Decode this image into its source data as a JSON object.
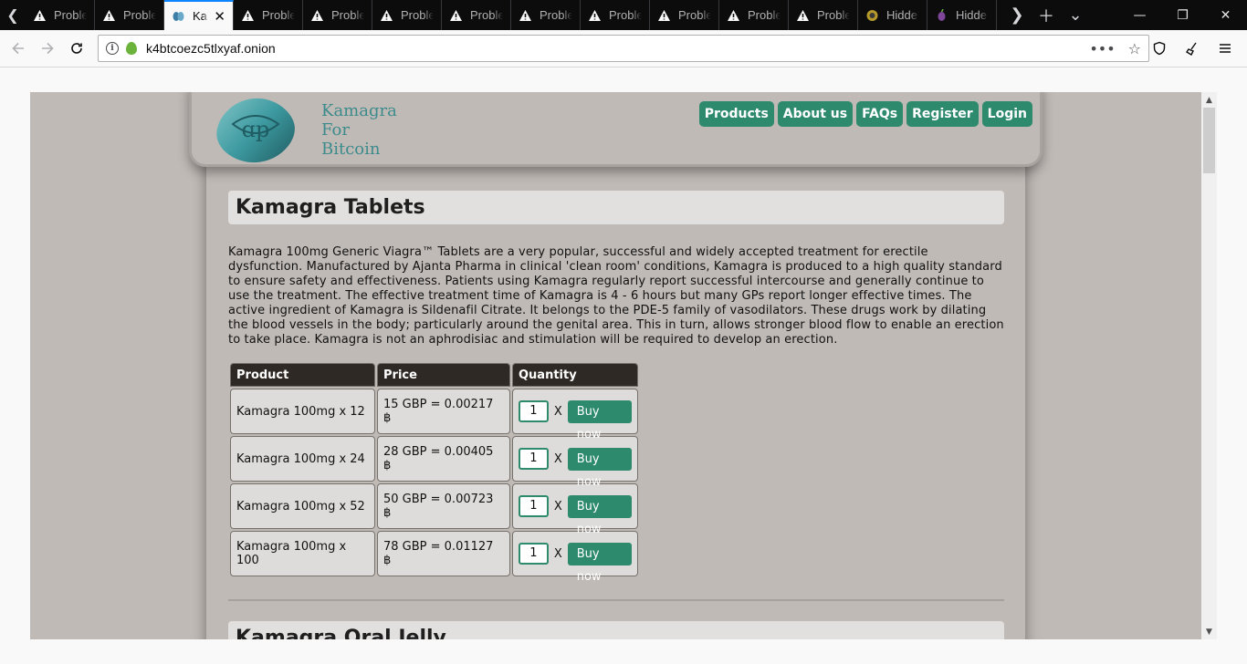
{
  "browser": {
    "tabs": [
      {
        "label": "Proble",
        "icon": "warning-icon"
      },
      {
        "label": "Proble",
        "icon": "warning-icon"
      },
      {
        "label": "Ka",
        "icon": "site-icon",
        "active": true
      },
      {
        "label": "Proble",
        "icon": "warning-icon"
      },
      {
        "label": "Proble",
        "icon": "warning-icon"
      },
      {
        "label": "Proble",
        "icon": "warning-icon"
      },
      {
        "label": "Proble",
        "icon": "warning-icon"
      },
      {
        "label": "Proble",
        "icon": "warning-icon"
      },
      {
        "label": "Proble",
        "icon": "warning-icon"
      },
      {
        "label": "Proble",
        "icon": "warning-icon"
      },
      {
        "label": "Proble",
        "icon": "warning-icon"
      },
      {
        "label": "Proble",
        "icon": "warning-icon"
      },
      {
        "label": "Hidde",
        "icon": "globe-icon"
      },
      {
        "label": "Hidde",
        "icon": "onion-icon"
      }
    ],
    "url": "k4btcoezc5tlxyaf.onion"
  },
  "site": {
    "brand": [
      "Kamagra",
      "For",
      "Bitcoin"
    ],
    "menu": [
      "Products",
      "About us",
      "FAQs",
      "Register",
      "Login"
    ]
  },
  "section1": {
    "title": "Kamagra Tablets",
    "description": "Kamagra 100mg Generic Viagra™ Tablets are a very popular, successful and widely accepted treatment for erectile dysfunction. Manufactured by Ajanta Pharma in clinical 'clean room' conditions, Kamagra is produced to a high quality standard to ensure safety and effectiveness. Patients using Kamagra regularly report successful intercourse and generally continue to use the treatment. The effective treatment time of Kamagra is 4 - 6 hours but many GPs report longer effective times. The active ingredient of Kamagra is Sildenafil Citrate. It belongs to the PDE-5 family of vasodilators. These drugs work by dilating the blood vessels in the body; particularly around the genital area. This in turn, allows stronger blood flow to enable an erection to take place. Kamagra is not an aphrodisiac and stimulation will be required to develop an erection.",
    "table": {
      "headers": [
        "Product",
        "Price",
        "Quantity"
      ],
      "rows": [
        {
          "product": "Kamagra 100mg x 12",
          "price": "15 GBP = 0.00217 ฿",
          "qty": "1",
          "x": "X",
          "button": "Buy now"
        },
        {
          "product": "Kamagra 100mg x 24",
          "price": "28 GBP = 0.00405 ฿",
          "qty": "1",
          "x": "X",
          "button": "Buy now"
        },
        {
          "product": "Kamagra 100mg x 52",
          "price": "50 GBP = 0.00723 ฿",
          "qty": "1",
          "x": "X",
          "button": "Buy now"
        },
        {
          "product": "Kamagra 100mg x 100",
          "price": "78 GBP = 0.01127 ฿",
          "qty": "1",
          "x": "X",
          "button": "Buy now"
        }
      ]
    }
  },
  "section2": {
    "title": "Kamagra Oral Jelly"
  },
  "colors": {
    "accent": "#2e8a6c",
    "page_bg": "#c0bab6",
    "brand_text": "#3c8b8c",
    "table_header": "#2e2924"
  }
}
